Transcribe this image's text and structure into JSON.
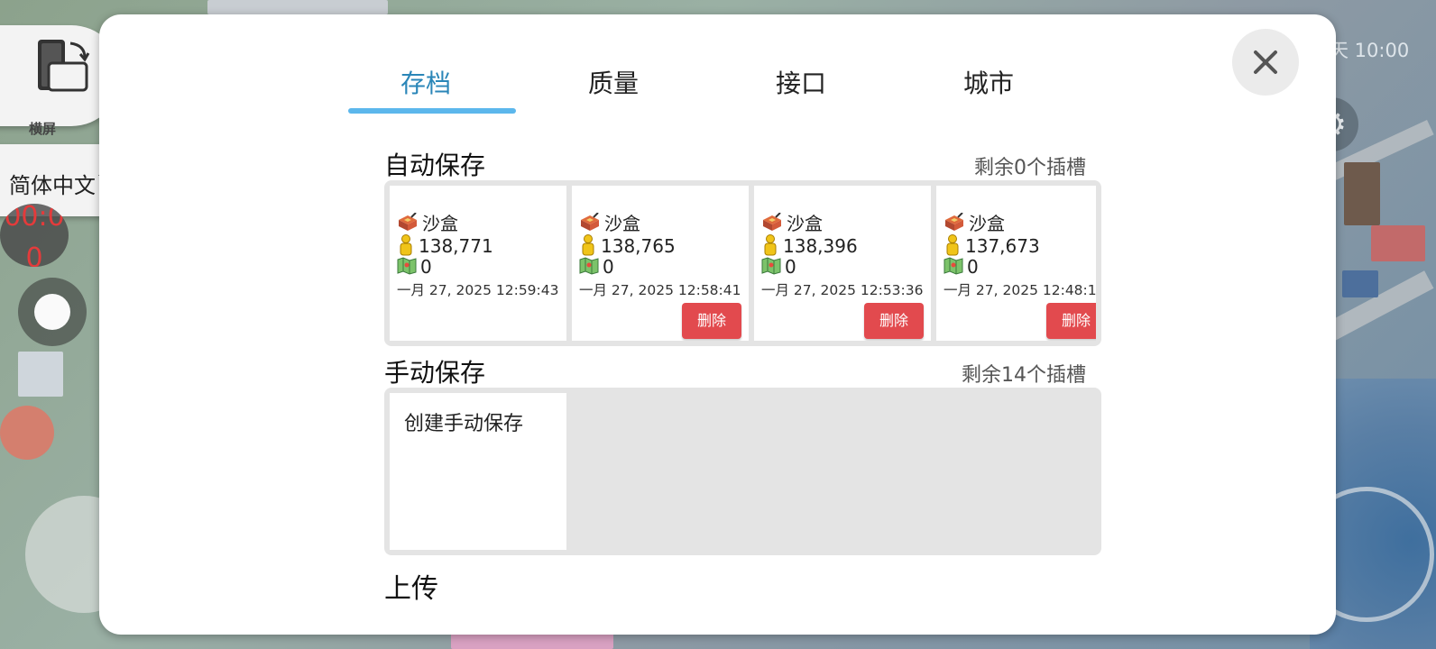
{
  "background": {
    "clock_text": "天 10:00"
  },
  "left_controls": {
    "rotate_label": "横屏",
    "language": "简体中文",
    "timer": "00:0\n0"
  },
  "tabs": [
    {
      "label": "存档",
      "active": true
    },
    {
      "label": "质量",
      "active": false
    },
    {
      "label": "接口",
      "active": false
    },
    {
      "label": "城市",
      "active": false
    }
  ],
  "auto_save": {
    "title": "自动保存",
    "slots_left": "剩余0个插槽",
    "cards": [
      {
        "mode": "沙盒",
        "population": "138,771",
        "value": "0",
        "date": "一月 27, 2025 12:59:43",
        "delete_label": ""
      },
      {
        "mode": "沙盒",
        "population": "138,765",
        "value": "0",
        "date": "一月 27, 2025 12:58:41",
        "delete_label": "删除"
      },
      {
        "mode": "沙盒",
        "population": "138,396",
        "value": "0",
        "date": "一月 27, 2025 12:53:36",
        "delete_label": "删除"
      },
      {
        "mode": "沙盒",
        "population": "137,673",
        "value": "0",
        "date": "一月 27, 2025 12:48:1",
        "delete_label": "删除"
      }
    ]
  },
  "manual_save": {
    "title": "手动保存",
    "slots_left": "剩余14个插槽",
    "create_label": "创建手动保存"
  },
  "upload": {
    "title": "上传"
  },
  "colors": {
    "accent": "#2a86b8",
    "tab_underline": "#5cb7ec",
    "delete": "#e24a4e"
  }
}
